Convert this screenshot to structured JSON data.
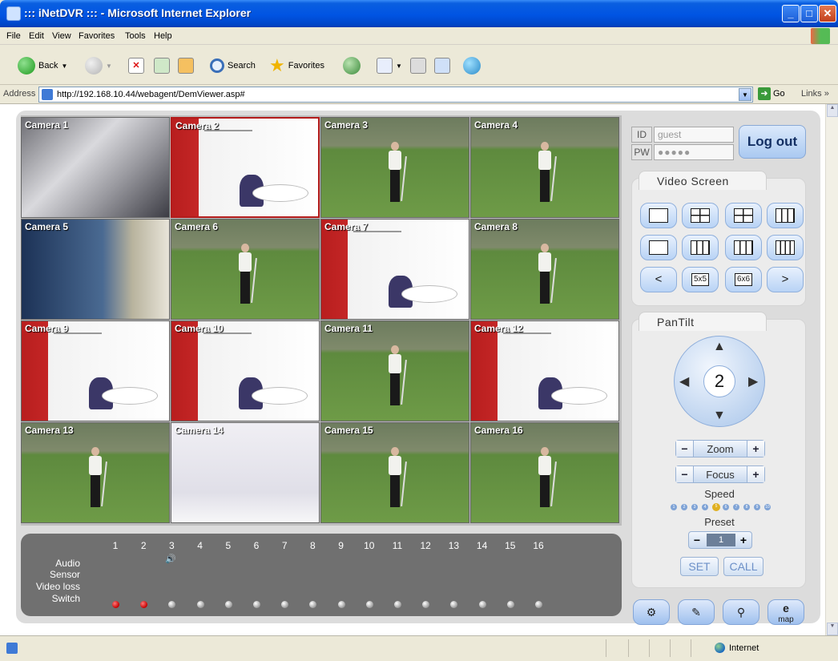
{
  "window": {
    "title": "::: iNetDVR ::: - Microsoft Internet Explorer"
  },
  "menu": [
    "File",
    "Edit",
    "View",
    "Favorites",
    "Tools",
    "Help"
  ],
  "toolbar": {
    "back": "Back",
    "search": "Search",
    "favorites": "Favorites"
  },
  "address": {
    "label": "Address",
    "url": "http://192.168.10.44/webagent/DemViewer.asp#",
    "go": "Go",
    "links": "Links"
  },
  "cameras": [
    {
      "label": "Camera 1",
      "scene": "server"
    },
    {
      "label": "Camera 2",
      "scene": "office",
      "selected": true
    },
    {
      "label": "Camera 3",
      "scene": "golf"
    },
    {
      "label": "Camera 4",
      "scene": "golf"
    },
    {
      "label": "Camera 5",
      "scene": "window"
    },
    {
      "label": "Camera 6",
      "scene": "golf"
    },
    {
      "label": "Camera 7",
      "scene": "office"
    },
    {
      "label": "Camera 8",
      "scene": "golf"
    },
    {
      "label": "Camera 9",
      "scene": "office"
    },
    {
      "label": "Camera 10",
      "scene": "office"
    },
    {
      "label": "Camera 11",
      "scene": "golf"
    },
    {
      "label": "Camera 12",
      "scene": "office"
    },
    {
      "label": "Camera 13",
      "scene": "golf"
    },
    {
      "label": "Camera 14",
      "scene": "fade"
    },
    {
      "label": "Camera 15",
      "scene": "golf"
    },
    {
      "label": "Camera 16",
      "scene": "golf"
    }
  ],
  "status": {
    "channels": [
      "1",
      "2",
      "3",
      "4",
      "5",
      "6",
      "7",
      "8",
      "9",
      "10",
      "11",
      "12",
      "13",
      "14",
      "15",
      "16"
    ],
    "rows": [
      "Audio",
      "Sensor",
      "Video loss",
      "Switch"
    ],
    "audio_active_channel": 3,
    "switch_red_channels": [
      1,
      2
    ]
  },
  "login": {
    "id_label": "ID",
    "pw_label": "PW",
    "id_value": "guest",
    "pw_value": "●●●●●",
    "logout": "Log out"
  },
  "video_screen": {
    "title": "Video Screen",
    "prev": "<",
    "next": ">",
    "btn_5x5": "5x5",
    "btn_6x6": "6x6"
  },
  "pantilt": {
    "title": "PanTilt",
    "channel": "2",
    "zoom": "Zoom",
    "focus": "Focus",
    "speed_label": "Speed",
    "speed_steps": [
      "1",
      "2",
      "3",
      "4",
      "5",
      "6",
      "7",
      "8",
      "9",
      "10"
    ],
    "speed_level": 5,
    "preset_label": "Preset",
    "preset_value": "1",
    "set": "SET",
    "call": "CALL",
    "map": "map"
  },
  "statusbar": {
    "zone": "Internet"
  }
}
